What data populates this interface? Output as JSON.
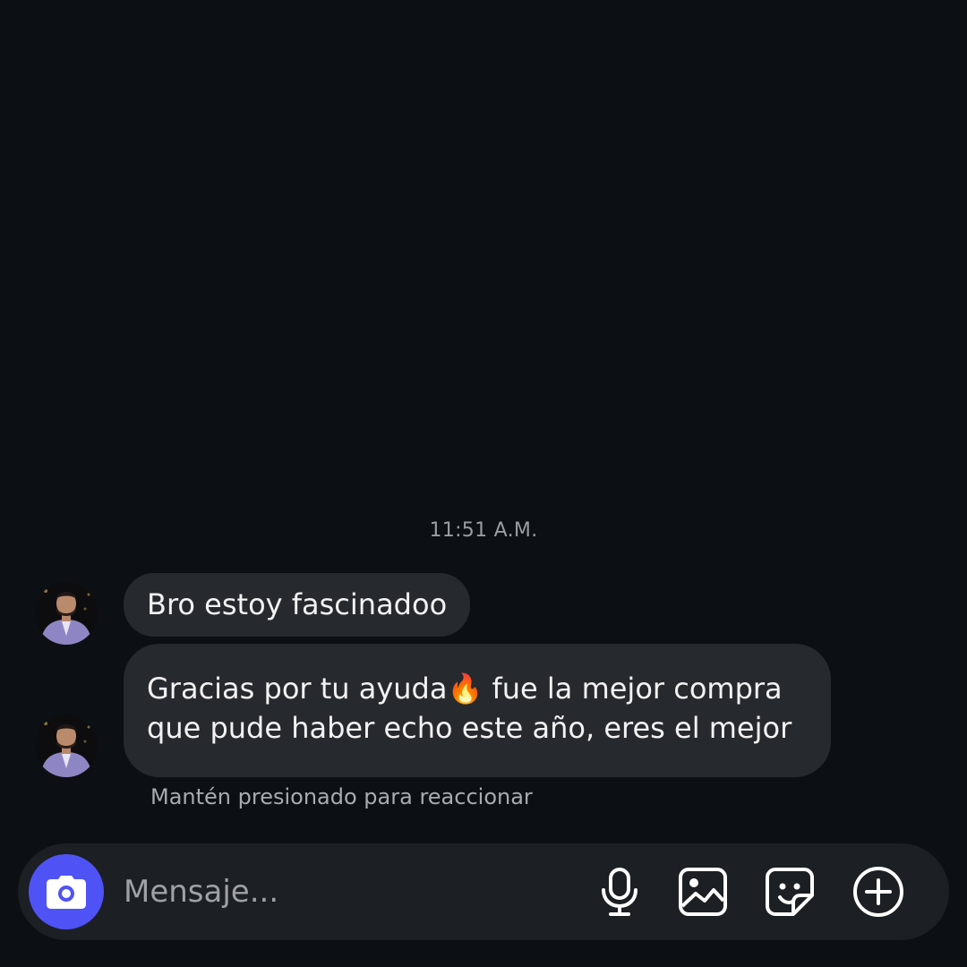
{
  "conversation": {
    "timestamp": "11:51 A.M.",
    "messages": [
      {
        "text": "Bro estoy fascinadoo"
      },
      {
        "line1": "Gracias por tu ayuda🔥 fue la mejor compra",
        "line2": "que pude haber echo este año, eres el mejor"
      }
    ],
    "hint": "Mantén presionado para reaccionar"
  },
  "composer": {
    "placeholder": "Mensaje...",
    "camera_icon": "camera-icon",
    "tools": [
      "microphone-icon",
      "image-icon",
      "sticker-icon",
      "plus-icon"
    ],
    "accent_color": "#4f53f5"
  }
}
